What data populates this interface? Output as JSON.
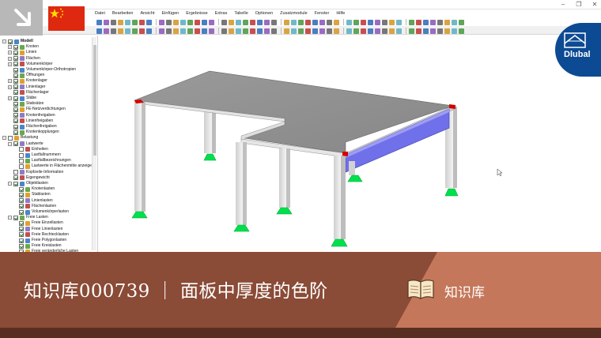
{
  "window": {
    "minimize_glyph": "–",
    "restore_glyph": "❐",
    "close_glyph": "✕"
  },
  "menu": [
    "Datei",
    "Bearbeiten",
    "Ansicht",
    "Einfügen",
    "Ergebnisse",
    "Extras",
    "Tabelle",
    "Optionen",
    "Zusatzmodule",
    "Fenster",
    "Hilfe"
  ],
  "navigator": {
    "items": [
      {
        "label": "Modell",
        "bold": true,
        "level": 0,
        "checked": true,
        "expander": "−"
      },
      {
        "label": "Knoten",
        "level": 1,
        "checked": true,
        "expander": "+"
      },
      {
        "label": "Linien",
        "level": 1,
        "checked": true,
        "expander": "+"
      },
      {
        "label": "Flächen",
        "level": 1,
        "checked": true,
        "expander": "+"
      },
      {
        "label": "Volumenkörper",
        "level": 1,
        "checked": true,
        "expander": "+"
      },
      {
        "label": "Volumenkörper-Orthotropien",
        "level": 1,
        "checked": true,
        "expander": ""
      },
      {
        "label": "Öffnungen",
        "level": 1,
        "checked": true,
        "expander": ""
      },
      {
        "label": "Knotenlager",
        "level": 1,
        "checked": true,
        "expander": "+"
      },
      {
        "label": "Linienlager",
        "level": 1,
        "checked": true,
        "expander": "+"
      },
      {
        "label": "Flächenlager",
        "level": 1,
        "checked": true,
        "expander": ""
      },
      {
        "label": "Stäbe",
        "level": 1,
        "checked": true,
        "expander": "+"
      },
      {
        "label": "Stabsätze",
        "level": 1,
        "checked": true,
        "expander": ""
      },
      {
        "label": "FE-Netzverdichtungen",
        "level": 1,
        "checked": true,
        "expander": ""
      },
      {
        "label": "Knotenfreigaben",
        "level": 1,
        "checked": true,
        "expander": ""
      },
      {
        "label": "Linienfreigaben",
        "level": 1,
        "checked": true,
        "expander": ""
      },
      {
        "label": "Flächenfreigaben",
        "level": 1,
        "checked": true,
        "expander": ""
      },
      {
        "label": "Knotenkopplungen",
        "level": 1,
        "checked": true,
        "expander": ""
      },
      {
        "label": "Belastung",
        "level": 0,
        "checked": false,
        "expander": "−"
      },
      {
        "label": "Lastwerte",
        "level": 1,
        "checked": true,
        "expander": "−"
      },
      {
        "label": "Einheiten",
        "level": 2,
        "checked": false,
        "expander": ""
      },
      {
        "label": "Lastfallnummern",
        "level": 2,
        "checked": false,
        "expander": ""
      },
      {
        "label": "Lastfallbezeichnungen",
        "level": 2,
        "checked": false,
        "expander": ""
      },
      {
        "label": "Lastwerte in Flächenmitte anzeigen",
        "level": 2,
        "checked": false,
        "expander": ""
      },
      {
        "label": "Kopfzeile-Information",
        "level": 1,
        "checked": false,
        "expander": ""
      },
      {
        "label": "Eigengewicht",
        "level": 1,
        "checked": true,
        "expander": ""
      },
      {
        "label": "Objektlasten",
        "level": 1,
        "checked": true,
        "expander": "−"
      },
      {
        "label": "Knotenlasten",
        "level": 2,
        "checked": true,
        "expander": ""
      },
      {
        "label": "Stablasten",
        "level": 2,
        "checked": true,
        "expander": ""
      },
      {
        "label": "Linienlasten",
        "level": 2,
        "checked": true,
        "expander": ""
      },
      {
        "label": "Flächenlasten",
        "level": 2,
        "checked": true,
        "expander": ""
      },
      {
        "label": "Volumenkörperlasten",
        "level": 2,
        "checked": true,
        "expander": ""
      },
      {
        "label": "Freie Lasten",
        "level": 1,
        "checked": true,
        "expander": "−"
      },
      {
        "label": "Freie Einzellasten",
        "level": 2,
        "checked": true,
        "expander": ""
      },
      {
        "label": "Freie Linienlasten",
        "level": 2,
        "checked": true,
        "expander": ""
      },
      {
        "label": "Freie Rechtecklasten",
        "level": 2,
        "checked": true,
        "expander": ""
      },
      {
        "label": "Freie Polygonlasten",
        "level": 2,
        "checked": true,
        "expander": ""
      },
      {
        "label": "Freie Kreislasten",
        "level": 2,
        "checked": true,
        "expander": ""
      },
      {
        "label": "Freie veränderliche Lasten",
        "level": 2,
        "checked": true,
        "expander": ""
      }
    ]
  },
  "logo": {
    "text": "Dlubal"
  },
  "banner": {
    "title": "知识库000739 ｜ 面板中厚度的色阶",
    "tag": "知识库"
  },
  "colors": {
    "banner_dark": "#8a4b37",
    "banner_light": "#c4775a",
    "logo_blue": "#0c4a93",
    "support_green": "#00e04c",
    "beam_blue": "#6e6ee8",
    "hinge_red": "#d40000"
  }
}
